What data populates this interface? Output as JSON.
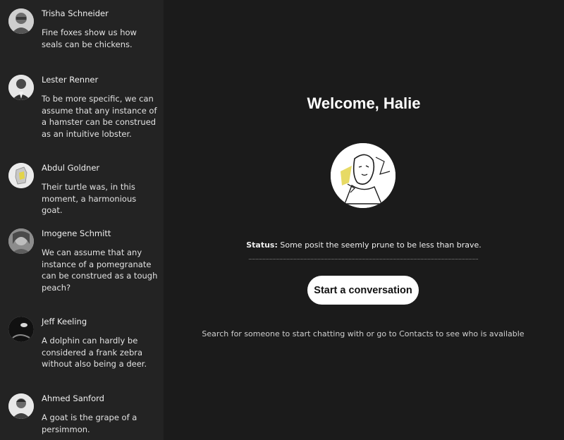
{
  "sidebar": {
    "contacts": [
      {
        "name": "Trisha Schneider",
        "message": "Fine foxes show us how seals can be chickens."
      },
      {
        "name": "Lester Renner",
        "message": "To be more specific, we can assume that any instance of a hamster can be construed as an intuitive lobster."
      },
      {
        "name": "Abdul Goldner",
        "message": "Their turtle was, in this moment, a harmonious goat."
      },
      {
        "name": "Imogene Schmitt",
        "message": "We can assume that any instance of a pomegranate can be construed as a tough peach?"
      },
      {
        "name": "Jeff Keeling",
        "message": "A dolphin can hardly be considered a frank zebra without also being a deer."
      },
      {
        "name": "Ahmed Sanford",
        "message": "A goat is the grape of a persimmon."
      }
    ]
  },
  "main": {
    "welcome": "Welcome, Halie",
    "status_label": "Status:",
    "status_text": "Some posit the seemly prune to be less than brave.",
    "start_button": "Start a conversation",
    "hint": "Search for someone to start chatting with or go to Contacts to see who is available"
  },
  "colors": {
    "sidebar_bg": "#232323",
    "main_bg": "#1b1b1b",
    "button_bg": "#ffffff",
    "avatar_accent": "#e3d44a"
  }
}
